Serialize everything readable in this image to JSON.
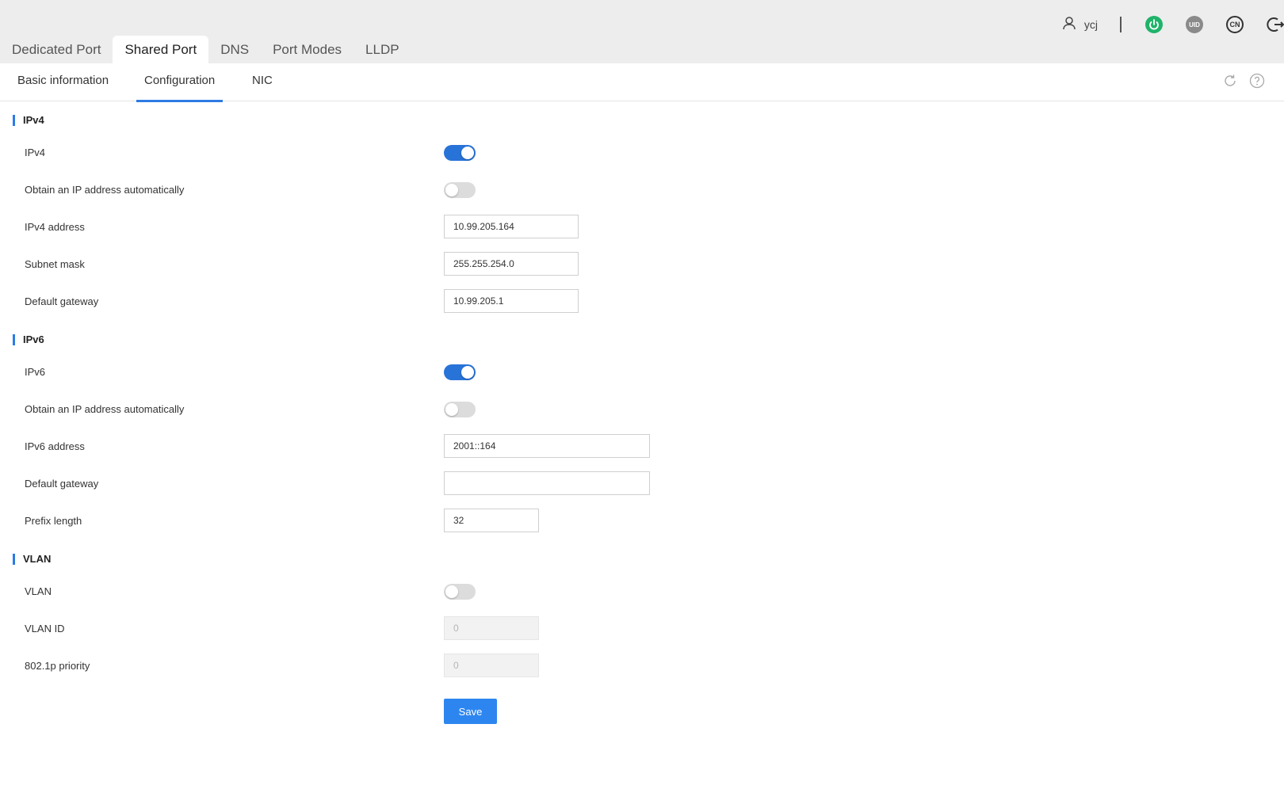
{
  "top_tabs": [
    "Dedicated Port",
    "Shared Port",
    "DNS",
    "Port Modes",
    "LLDP"
  ],
  "user": {
    "name": "ycj"
  },
  "header_icons": {
    "uid_label": "UID",
    "lang_label": "CN",
    "power_color": "#1fb36a"
  },
  "sub_tabs": [
    "Basic information",
    "Configuration",
    "NIC"
  ],
  "ipv4": {
    "title": "IPv4",
    "enable_label": "IPv4",
    "auto_label": "Obtain an IP address automatically",
    "address_label": "IPv4 address",
    "address_value": "10.99.205.164",
    "subnet_label": "Subnet mask",
    "subnet_value": "255.255.254.0",
    "gateway_label": "Default gateway",
    "gateway_value": "10.99.205.1"
  },
  "ipv6": {
    "title": "IPv6",
    "enable_label": "IPv6",
    "auto_label": "Obtain an IP address automatically",
    "address_label": "IPv6 address",
    "address_value": "2001::164",
    "gateway_label": "Default gateway",
    "gateway_value": "",
    "prefix_label": "Prefix length",
    "prefix_value": "32"
  },
  "vlan": {
    "title": "VLAN",
    "enable_label": "VLAN",
    "id_label": "VLAN ID",
    "id_value": "0",
    "priority_label": "802.1p priority",
    "priority_value": "0"
  },
  "save_label": "Save",
  "colors": {
    "accent": "#2d7be5",
    "toggle_on": "#2873d8",
    "button": "#2d86f0"
  }
}
